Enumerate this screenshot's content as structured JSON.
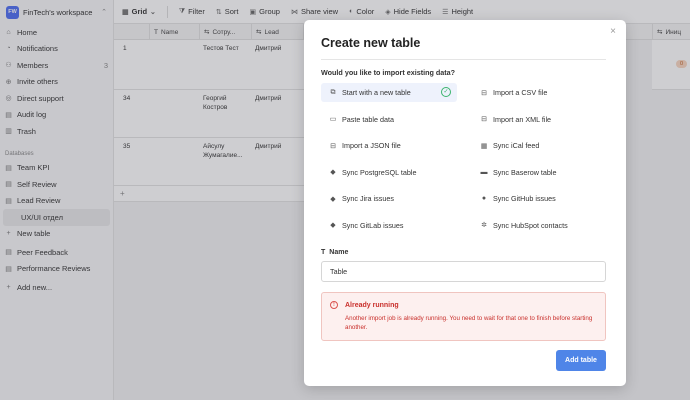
{
  "workspace": {
    "logo": "FW",
    "name": "FinTech's workspace"
  },
  "sidebar": {
    "nav": [
      {
        "label": "Home",
        "icon": "home-icon",
        "glyph": "⌂"
      },
      {
        "label": "Notifications",
        "icon": "bell-icon",
        "glyph": "◔"
      },
      {
        "label": "Members",
        "icon": "members-icon",
        "glyph": "⚇",
        "count": "3"
      },
      {
        "label": "Invite others",
        "icon": "invite-icon",
        "glyph": "⊕"
      },
      {
        "label": "Direct support",
        "icon": "support-icon",
        "glyph": "◎"
      },
      {
        "label": "Audit log",
        "icon": "audit-icon",
        "glyph": "▤"
      },
      {
        "label": "Trash",
        "icon": "trash-icon",
        "glyph": "▥"
      }
    ],
    "databases_heading": "Databases",
    "databases": [
      {
        "label": "Team KPI"
      },
      {
        "label": "Self Review"
      },
      {
        "label": "Lead Review"
      }
    ],
    "active_table": "UX/UI отдел",
    "new_table": "New table",
    "more_databases": [
      {
        "label": "Peer Feedback"
      },
      {
        "label": "Performance Reviews"
      }
    ],
    "add_new": "Add new..."
  },
  "toolbar": {
    "grid": "Grid",
    "filter": "Filter",
    "sort": "Sort",
    "group": "Group",
    "share": "Share view",
    "color": "Color",
    "hide": "Hide Fields",
    "height": "Height"
  },
  "grid": {
    "columns": [
      "Name",
      "Сотру...",
      "Lead",
      "Иниц"
    ],
    "rows": [
      {
        "num": "1",
        "employee": "Тестов Тест",
        "lead": "Дмитрий"
      },
      {
        "num": "34",
        "employee": "Георгий Костров",
        "lead": "Дмитрий"
      },
      {
        "num": "35",
        "employee": "Айсулу Жумагалие...",
        "lead": "Дмитрий"
      }
    ],
    "add_row": "+",
    "badge": "0"
  },
  "modal": {
    "title": "Create new table",
    "question": "Would you like to import existing data?",
    "options": [
      {
        "label": "Start with a new table",
        "icon": "new-table-icon",
        "glyph": "⧉"
      },
      {
        "label": "Import a CSV file",
        "icon": "csv-icon",
        "glyph": "⊟"
      },
      {
        "label": "Paste table data",
        "icon": "paste-icon",
        "glyph": "▭"
      },
      {
        "label": "Import an XML file",
        "icon": "xml-icon",
        "glyph": "⊟"
      },
      {
        "label": "Import a JSON file",
        "icon": "json-icon",
        "glyph": "⊟"
      },
      {
        "label": "Sync iCal feed",
        "icon": "calendar-icon",
        "glyph": "▦"
      },
      {
        "label": "Sync PostgreSQL table",
        "icon": "postgresql-icon",
        "glyph": "◆"
      },
      {
        "label": "Sync Baserow table",
        "icon": "baserow-icon",
        "glyph": "▬"
      },
      {
        "label": "Sync Jira issues",
        "icon": "jira-icon",
        "glyph": "◆"
      },
      {
        "label": "Sync GitHub issues",
        "icon": "github-icon",
        "glyph": "●"
      },
      {
        "label": "Sync GitLab issues",
        "icon": "gitlab-icon",
        "glyph": "◆"
      },
      {
        "label": "Sync HubSpot contacts",
        "icon": "hubspot-icon",
        "glyph": "✲"
      }
    ],
    "name_label": "Name",
    "name_value": "Table",
    "alert_title": "Already running",
    "alert_text": "Another import job is already running. You need to wait for that one to finish before starting another.",
    "add_button": "Add table",
    "close": "×"
  },
  "colors": {
    "accent": "#4f85e8",
    "logo": "#4e6ef2",
    "success": "#3bb46d",
    "error": "#c9302c"
  }
}
